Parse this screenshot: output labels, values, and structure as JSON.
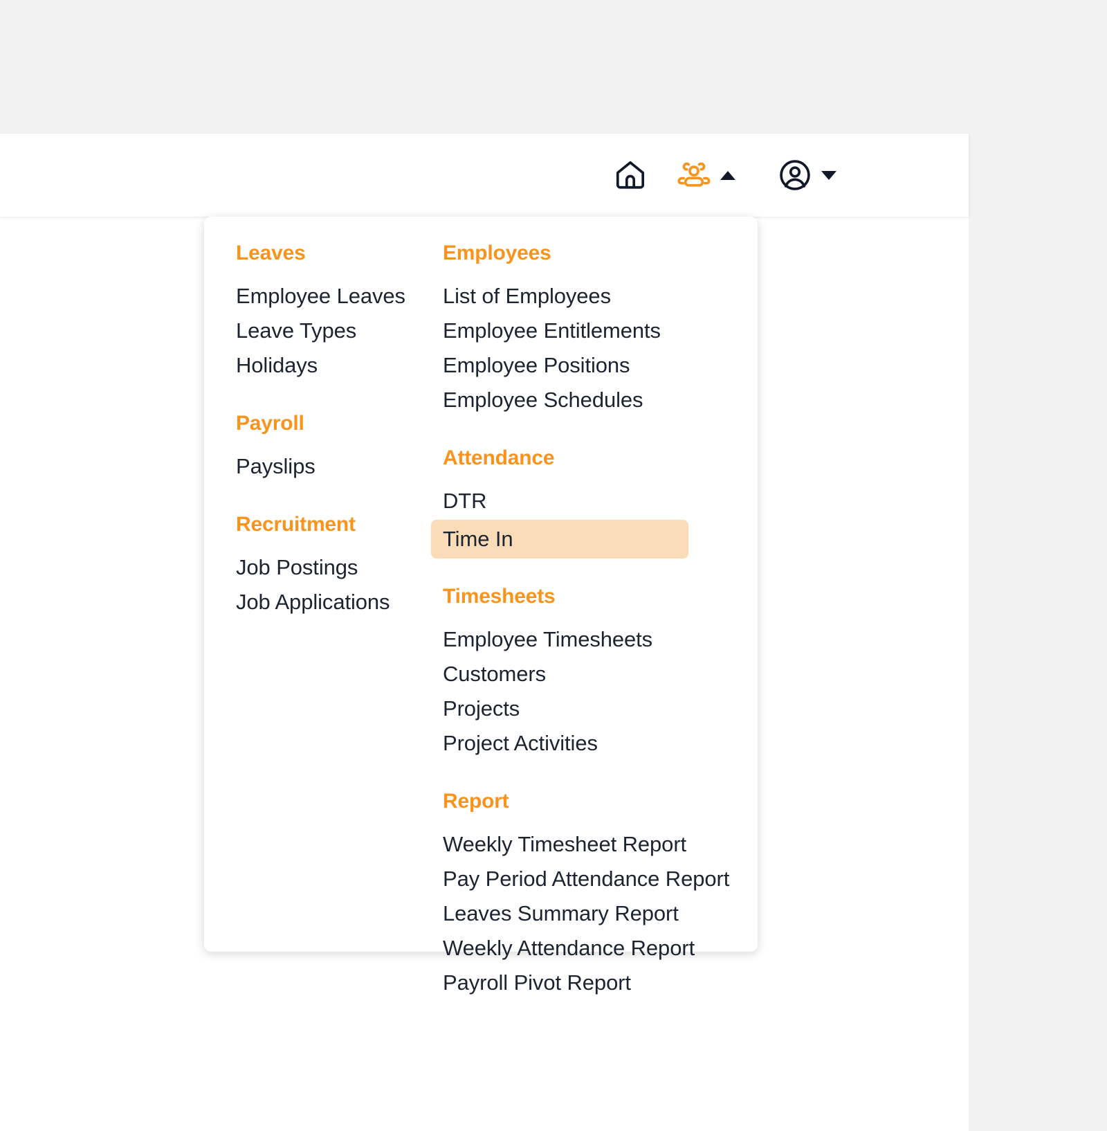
{
  "theme": {
    "accent": "#F7941E",
    "active_item_bg": "#FBDCB8",
    "text": "#1b2430",
    "page_bg": "#f2f2f2",
    "surface": "#ffffff"
  },
  "top_bar": {
    "home_icon": "home-icon",
    "employees_icon": "people-group-icon",
    "employees_caret_icon": "caret-up-icon",
    "profile_icon": "user-circle-icon",
    "profile_caret_icon": "caret-down-icon"
  },
  "mega_menu": {
    "left_column": [
      {
        "heading": "Leaves",
        "items": [
          {
            "label": "Employee Leaves",
            "active": false
          },
          {
            "label": "Leave Types",
            "active": false
          },
          {
            "label": "Holidays",
            "active": false
          }
        ]
      },
      {
        "heading": "Payroll",
        "items": [
          {
            "label": "Payslips",
            "active": false
          }
        ]
      },
      {
        "heading": "Recruitment",
        "items": [
          {
            "label": "Job Postings",
            "active": false
          },
          {
            "label": "Job Applications",
            "active": false
          }
        ]
      }
    ],
    "right_column": [
      {
        "heading": "Employees",
        "items": [
          {
            "label": "List of Employees",
            "active": false
          },
          {
            "label": "Employee Entitlements",
            "active": false
          },
          {
            "label": "Employee Positions",
            "active": false
          },
          {
            "label": "Employee Schedules",
            "active": false
          }
        ]
      },
      {
        "heading": "Attendance",
        "items": [
          {
            "label": "DTR",
            "active": false
          },
          {
            "label": "Time In",
            "active": true
          }
        ]
      },
      {
        "heading": "Timesheets",
        "items": [
          {
            "label": "Employee Timesheets",
            "active": false
          },
          {
            "label": "Customers",
            "active": false
          },
          {
            "label": "Projects",
            "active": false
          },
          {
            "label": "Project Activities",
            "active": false
          }
        ]
      },
      {
        "heading": "Report",
        "items": [
          {
            "label": "Weekly Timesheet Report",
            "active": false
          },
          {
            "label": "Pay Period Attendance Report",
            "active": false
          },
          {
            "label": "Leaves Summary Report",
            "active": false
          },
          {
            "label": "Weekly Attendance Report",
            "active": false
          },
          {
            "label": "Payroll Pivot Report",
            "active": false
          }
        ]
      }
    ]
  }
}
